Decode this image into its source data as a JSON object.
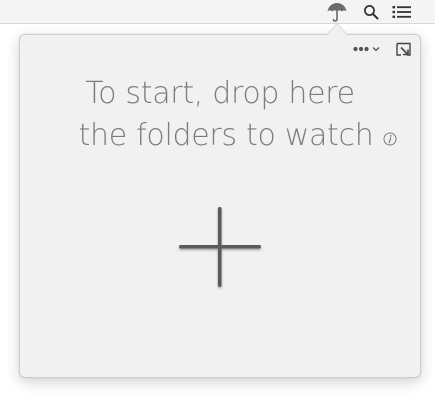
{
  "menubar": {
    "items": [
      {
        "icon": "umbrella-icon"
      },
      {
        "icon": "search-icon"
      },
      {
        "icon": "list-icon"
      }
    ]
  },
  "popover": {
    "prompt_line1": "To start, drop here",
    "prompt_line2": "the folders to watch",
    "toolbar": {
      "more_icon": "ellipsis-icon",
      "chevron_icon": "chevron-down-icon",
      "detach_icon": "detach-window-icon"
    },
    "info_icon": "info-icon",
    "add_icon": "plus-icon"
  },
  "colors": {
    "menubar_bg": "#f4f4f4",
    "popover_bg": "#f1f1f1",
    "text": "#7c7c7c",
    "plus": "#5a5a5a"
  }
}
